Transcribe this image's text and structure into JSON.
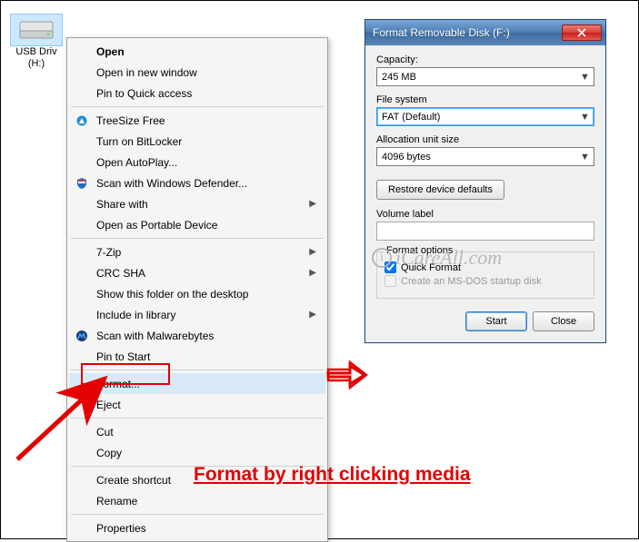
{
  "desktop": {
    "drive_label": "USB Driv\n(H:)"
  },
  "menu": {
    "items": [
      {
        "label": "Open",
        "bold": true
      },
      {
        "label": "Open in new window"
      },
      {
        "label": "Pin to Quick access"
      },
      {
        "sep": true
      },
      {
        "label": "TreeSize Free",
        "icon": "treesize"
      },
      {
        "label": "Turn on BitLocker"
      },
      {
        "label": "Open AutoPlay..."
      },
      {
        "label": "Scan with Windows Defender...",
        "icon": "defender"
      },
      {
        "label": "Share with",
        "sub": true
      },
      {
        "label": "Open as Portable Device"
      },
      {
        "sep": true
      },
      {
        "label": "7-Zip",
        "sub": true
      },
      {
        "label": "CRC SHA",
        "sub": true
      },
      {
        "label": "Show this folder on the desktop"
      },
      {
        "label": "Include in library",
        "sub": true
      },
      {
        "label": "Scan with Malwarebytes",
        "icon": "malwarebytes"
      },
      {
        "label": "Pin to Start"
      },
      {
        "sep": true
      },
      {
        "label": "Format...",
        "hover": true
      },
      {
        "label": "Eject"
      },
      {
        "sep": true
      },
      {
        "label": "Cut"
      },
      {
        "label": "Copy"
      },
      {
        "sep": true
      },
      {
        "label": "Create shortcut"
      },
      {
        "label": "Rename"
      },
      {
        "sep": true
      },
      {
        "label": "Properties"
      }
    ]
  },
  "dialog": {
    "title": "Format Removable Disk (F:)",
    "capacity_label": "Capacity:",
    "capacity_value": "245 MB",
    "filesystem_label": "File system",
    "filesystem_value": "FAT (Default)",
    "allocation_label": "Allocation unit size",
    "allocation_value": "4096 bytes",
    "restore_btn": "Restore device defaults",
    "volume_label": "Volume label",
    "volume_value": "",
    "options_legend": "Format options",
    "quick_format": "Quick Format",
    "msdos": "Create an MS-DOS startup disk",
    "start_btn": "Start",
    "close_btn": "Close"
  },
  "caption": "Format by right clicking media",
  "watermark": "iCareAll.com",
  "colors": {
    "accent_red": "#e30000"
  }
}
